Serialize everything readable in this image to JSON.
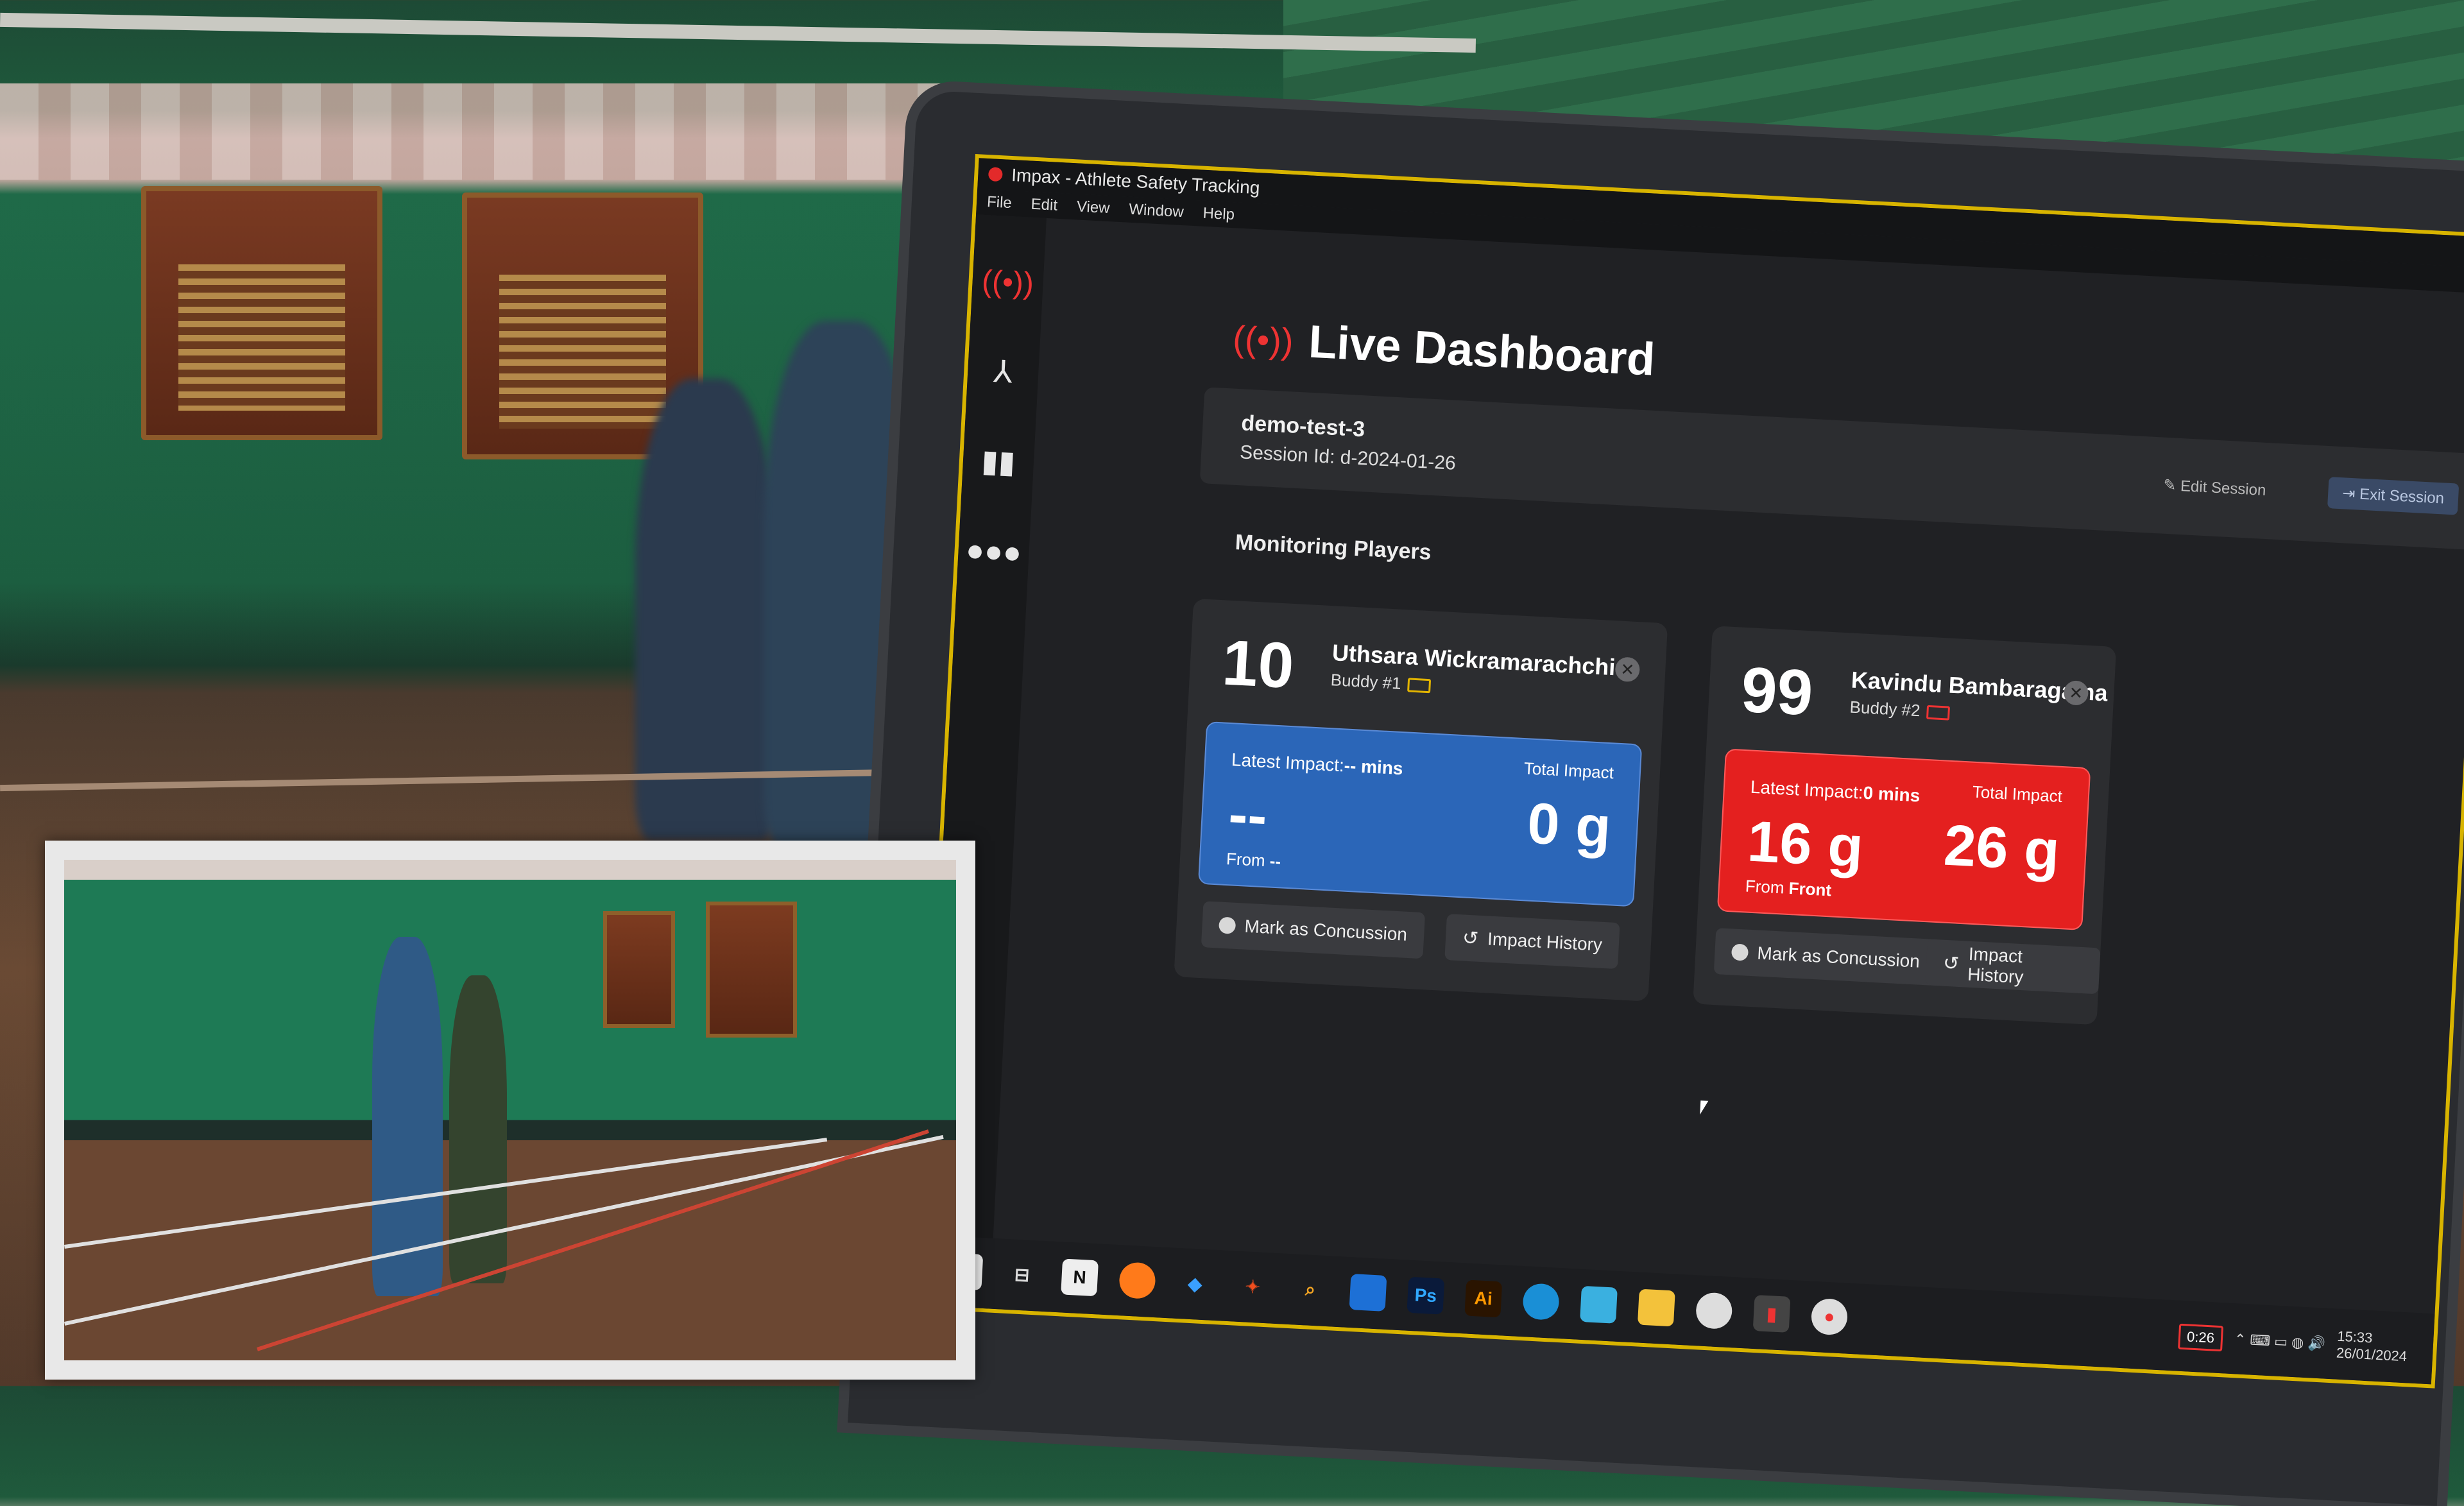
{
  "window": {
    "title": "Impax - Athlete Safety Tracking"
  },
  "menu": [
    "File",
    "Edit",
    "View",
    "Window",
    "Help"
  ],
  "sidebar": {
    "items": [
      {
        "icon": "broadcast-icon"
      },
      {
        "icon": "network-icon"
      },
      {
        "icon": "bar-chart-icon"
      },
      {
        "icon": "users-icon"
      }
    ],
    "footer_icon": "user-circle-icon"
  },
  "dashboard": {
    "title": "Live Dashboard",
    "session": {
      "name": "demo-test-3",
      "id_text": "Session Id: d-2024-01-26",
      "edit_label": "Edit Session",
      "exit_label": "Exit Session"
    },
    "section_label": "Monitoring Players",
    "players": [
      {
        "number": "10",
        "name": "Uthsara Wickramarachchi",
        "buddy": "Buddy #1",
        "latest_label": "Latest Impact:",
        "latest_time": "-- mins",
        "total_label": "Total Impact",
        "latest_value": "--",
        "total_value": "0 g",
        "from_label": "From",
        "from_value": "--",
        "concussion_label": "Mark as Concussion",
        "history_label": "Impact History",
        "color": "#2b66b8"
      },
      {
        "number": "99",
        "name": "Kavindu Bambaragama",
        "buddy": "Buddy #2",
        "latest_label": "Latest Impact:",
        "latest_time": "0 mins",
        "total_label": "Total Impact",
        "latest_value": "16 g",
        "total_value": "26 g",
        "from_label": "From",
        "from_value": "Front",
        "concussion_label": "Mark as Concussion",
        "history_label": "Impact History",
        "color": "#e4201f"
      }
    ]
  },
  "taskbar": {
    "rec_time": "0:26",
    "clock_time": "15:33",
    "clock_date": "26/01/2024"
  },
  "colors": {
    "accent": "#e4201f",
    "blue": "#2b66b8",
    "bezel": "#d8b400"
  }
}
